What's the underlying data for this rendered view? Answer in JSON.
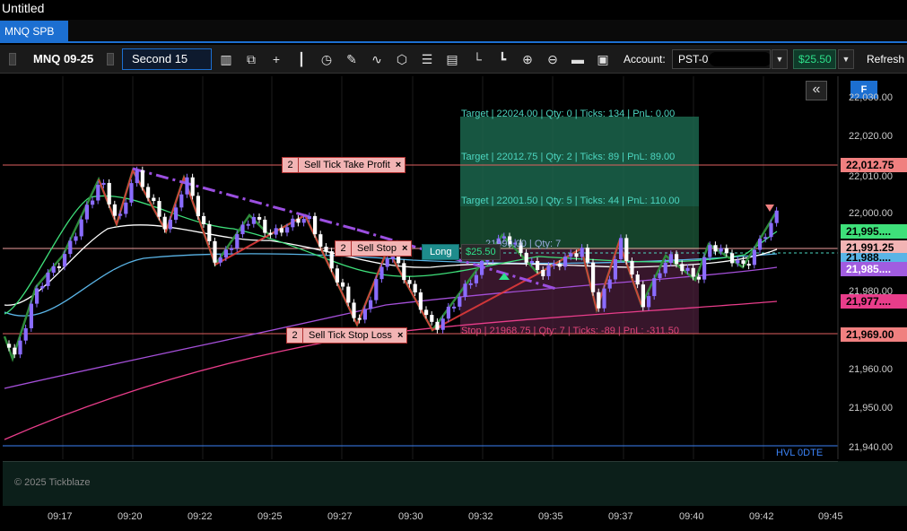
{
  "window": {
    "title": "Untitled"
  },
  "tabs": [
    {
      "label": "MNQ SPB"
    }
  ],
  "toolbar": {
    "instrument": "MNQ 09-25",
    "interval": "Second 15",
    "account_label": "Account:",
    "account_value": "PST-0",
    "pnl_value": "$25.50",
    "refresh_label": "Refresh"
  },
  "icons": [
    "bars-icon",
    "chart-type-icon",
    "crosshair-icon",
    "candles-icon",
    "clock-icon",
    "pencil-icon",
    "zigzag-icon",
    "cube-icon",
    "list-icon",
    "doc-icon",
    "axis-icon",
    "axis-alt-icon",
    "zoom-in-icon",
    "zoom-out-icon",
    "folder-icon",
    "save-icon"
  ],
  "orders": {
    "take_profit": {
      "qty": "2",
      "label": "Sell Tick Take Profit",
      "close": "×"
    },
    "sell_stop": {
      "qty": "2",
      "label": "Sell Stop",
      "close": "×"
    },
    "stop_loss": {
      "qty": "2",
      "label": "Sell Tick Stop Loss",
      "close": "×"
    }
  },
  "position": {
    "side": "Long",
    "pnl": "$25.50",
    "entry_text": "21990.00 | Qty: 7"
  },
  "targets": [
    {
      "text": "Target | 22024.00 | Qty: 0 | Ticks: 134 | PnL: 0.00"
    },
    {
      "text": "Target | 22012.75 | Qty: 2 | Ticks: 89 | PnL: 89.00"
    },
    {
      "text": "Target | 22001.50 | Qty: 5 | Ticks: 44 | PnL: 110.00"
    }
  ],
  "stop": {
    "text": "Stop | 21968.75 | Qty: 7 | Ticks: -89 | PnL: -311.50"
  },
  "hvl_label": "HVL 0DTE",
  "collapse_glyph": "«",
  "f_button": "F",
  "price_axis": {
    "labels": [
      "22,030.00",
      "22,020.00",
      "22,010.00",
      "22,000.00",
      "21,990.00",
      "21,980.00",
      "21,970.00",
      "21,960.00",
      "21,950.00",
      "21,940.00"
    ],
    "tags": [
      {
        "value": "22,012.75",
        "color": "#f08080"
      },
      {
        "value": "21,995....",
        "color": "#3ee07a"
      },
      {
        "value": "21,991.25",
        "color": "#f2b4b4"
      },
      {
        "value": "21,988....",
        "color": "#5ab4e6"
      },
      {
        "value": "21,985....",
        "color": "#a15ce0"
      },
      {
        "value": "21,977....",
        "color": "#e83d8a"
      },
      {
        "value": "21,969.00",
        "color": "#f08080"
      }
    ]
  },
  "time_axis": [
    "09:17",
    "09:20",
    "09:22",
    "09:25",
    "09:27",
    "09:30",
    "09:32",
    "09:35",
    "09:37",
    "09:40",
    "09:42",
    "09:45"
  ],
  "watermark": "© 2025 Tickblaze",
  "colors": {
    "accent": "#1c6fd1",
    "up": "#8a6cff",
    "down": "#ffffff",
    "zigzag_up": "#2e8b3a",
    "zigzag_down": "#e03a3a"
  }
}
